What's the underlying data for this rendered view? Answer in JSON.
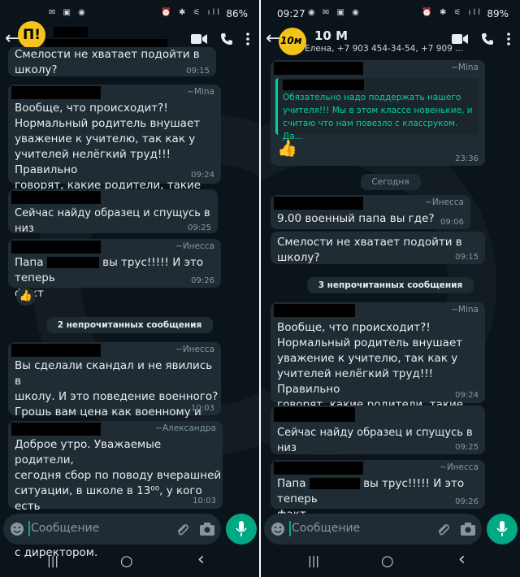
{
  "left": {
    "status": {
      "icons": "✉ ▣ ◉",
      "right_icons": "⏰ ✱ ⚟ ıll",
      "battery": "86%"
    },
    "header": {
      "back": "←",
      "logo": "П!"
    },
    "messages": [
      {
        "text": "Смелости не хватает подойти в школу?",
        "time": "09:15"
      },
      {
        "sender": "~Mina",
        "text": "Вообще, что происходит?!\nНормальный родитель внушает\nуважение к учителю, так как у\nучителей нелёгкий труд!!! Правильно\nговорят, какие родители, такие дети!",
        "time": "09:24"
      },
      {
        "text": "Сейчас найду образец и спущусь в низ",
        "time": "09:25"
      },
      {
        "sender": "~Инесса",
        "text_a": "Папа",
        "text_b": "вы трус!!!!! И это теперь",
        "text_c": "факт",
        "time": "09:26",
        "reaction": "👍"
      },
      {
        "text": "Вы сделали скандал и не явились в\nшколу. И это поведение военного?\nГрошь вам цена как военному и как\nчеловеку.",
        "sender": "~Инесса",
        "time": "10:03"
      },
      {
        "sender": "~Александра",
        "text": "Доброе утро. Уважаемые родители,\nсегодня сбор по поводу вчерашней\nситуации, в школе в 13⁰⁰, у кого есть\nвозможность подойдите, будет встреча\nс директором.",
        "time": "10:03"
      }
    ],
    "unread": "2 непрочитанных сообщения",
    "input_placeholder": "Сообщение"
  },
  "right": {
    "status": {
      "time": "09:27",
      "icons": "◉ ✉ ▣ ◉",
      "right_icons": "⏰ ✱ ⚟ ıll",
      "battery": "89%"
    },
    "header": {
      "back": "←",
      "name": "10 М",
      "sub": "Елена, +7 903 454-34-54, +7 909 ...",
      "avatar_text": "10м"
    },
    "quoted": {
      "sender": "~Mina",
      "text": "Обязательно надо поддержать нашего\nучителя!!! Мы в этом классе новенькие, и\nсчитаю что нам повезло с классруком. Да...",
      "sticker": "👍",
      "time": "23:36"
    },
    "day": "Сегодня",
    "messages": [
      {
        "sender": "~Инесса",
        "text": "9.00 военный папа вы где?",
        "time": "09:06"
      },
      {
        "text": "Смелости не хватает подойти в школу?",
        "time": "09:15"
      },
      {
        "sender": "~Mina",
        "text": "Вообще, что происходит?!\nНормальный родитель внушает\nуважение к учителю, так как у\nучителей нелёгкий труд!!! Правильно\nговорят, какие родители, такие дети!",
        "time": "09:24"
      },
      {
        "text": "Сейчас найду образец и спущусь в низ",
        "time": "09:25"
      },
      {
        "sender": "~Инесса",
        "text_a": "Папа",
        "text_b": "вы трус!!!!! И это теперь",
        "text_c": "факт",
        "time": "09:26"
      }
    ],
    "unread": "3 непрочитанных сообщения",
    "input_placeholder": "Сообщение"
  },
  "nav": {
    "recent": "|||",
    "home": "○",
    "back": "‹"
  },
  "colors": {
    "accent": "#00a884",
    "bubble": "#1f2c34",
    "background": "#0b141a"
  }
}
